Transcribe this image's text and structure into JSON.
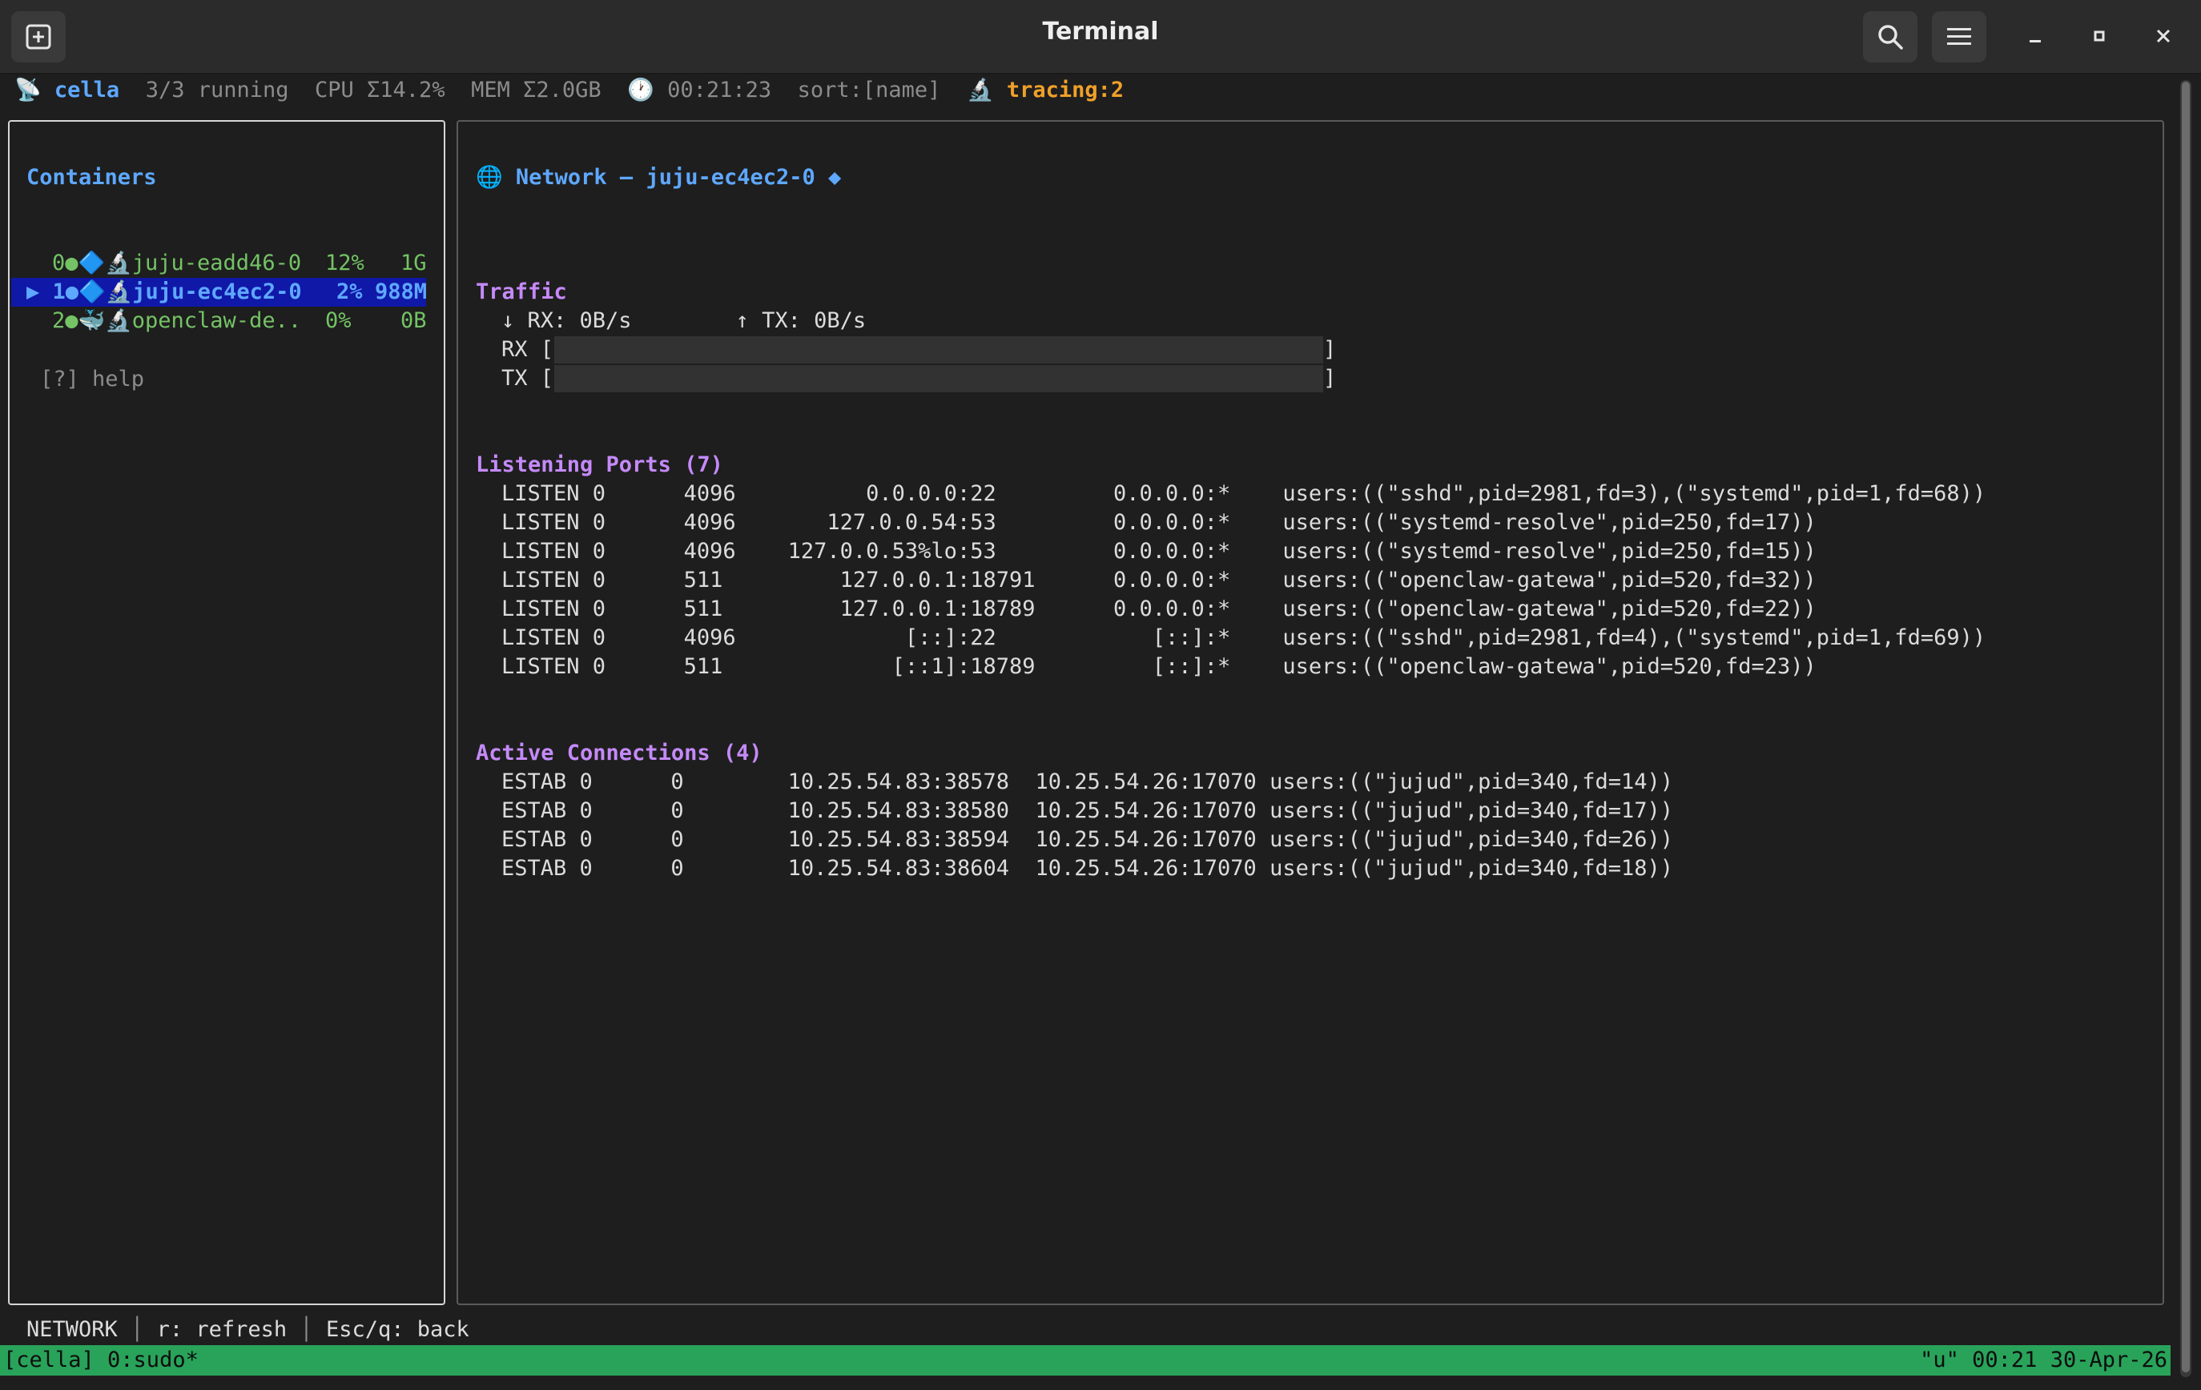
{
  "window": {
    "title": "Terminal",
    "new_tab_icon": "new-tab-icon",
    "search_icon": "search-icon",
    "menu_icon": "hamburger-menu-icon",
    "minimize_icon": "minimize-icon",
    "maximize_icon": "maximize-icon",
    "close_icon": "close-icon"
  },
  "status": {
    "host_icon": "📡",
    "host": "cella",
    "running": "3/3 running",
    "cpu": "CPU Σ14.2%",
    "mem": "MEM Σ2.0GB",
    "clock_icon": "🕐",
    "uptime": "00:21:23",
    "sort": "sort:[name]",
    "tracing_icon": "🔬",
    "tracing": "tracing:2"
  },
  "containers": {
    "title": "Containers",
    "items": [
      {
        "index": "0",
        "icons": "●🔷🔬",
        "name": "juju-eadd46-0",
        "cpu": "12%",
        "mem": "1G",
        "selected": false
      },
      {
        "index": "1",
        "icons": "●🔷🔬",
        "name": "juju-ec4ec2-0",
        "cpu": "2%",
        "mem": "988M",
        "selected": true
      },
      {
        "index": "2",
        "icons": "●🐳🔬",
        "name": "openclaw-de..",
        "cpu": "0%",
        "mem": "0B",
        "selected": false
      }
    ],
    "selector": "▶",
    "help": "[?] help"
  },
  "network": {
    "globe_icon": "🌐",
    "title": "Network — juju-ec4ec2-0",
    "diamond": "◆",
    "traffic": {
      "heading": "Traffic",
      "rates": "↓ RX: 0B/s        ↑ TX: 0B/s",
      "rx_label": "RX [",
      "tx_label": "TX [",
      "bracket_close": "]",
      "rx_fraction": 0,
      "tx_fraction": 0
    },
    "listening": {
      "heading": "Listening Ports (7)",
      "rows": [
        "LISTEN 0      4096          0.0.0.0:22         0.0.0.0:*    users:((\"sshd\",pid=2981,fd=3),(\"systemd\",pid=1,fd=68))",
        "LISTEN 0      4096       127.0.0.54:53         0.0.0.0:*    users:((\"systemd-resolve\",pid=250,fd=17))",
        "LISTEN 0      4096    127.0.0.53%lo:53         0.0.0.0:*    users:((\"systemd-resolve\",pid=250,fd=15))",
        "LISTEN 0      511         127.0.0.1:18791      0.0.0.0:*    users:((\"openclaw-gatewa\",pid=520,fd=32))",
        "LISTEN 0      511         127.0.0.1:18789      0.0.0.0:*    users:((\"openclaw-gatewa\",pid=520,fd=22))",
        "LISTEN 0      4096             [::]:22            [::]:*    users:((\"sshd\",pid=2981,fd=4),(\"systemd\",pid=1,fd=69))",
        "LISTEN 0      511             [::1]:18789         [::]:*    users:((\"openclaw-gatewa\",pid=520,fd=23))"
      ]
    },
    "active": {
      "heading": "Active Connections (4)",
      "rows": [
        "ESTAB 0      0        10.25.54.83:38578  10.25.54.26:17070 users:((\"jujud\",pid=340,fd=14))",
        "ESTAB 0      0        10.25.54.83:38580  10.25.54.26:17070 users:((\"jujud\",pid=340,fd=17))",
        "ESTAB 0      0        10.25.54.83:38594  10.25.54.26:17070 users:((\"jujud\",pid=340,fd=26))",
        "ESTAB 0      0        10.25.54.83:38604  10.25.54.26:17070 users:((\"jujud\",pid=340,fd=18))"
      ]
    }
  },
  "hints": {
    "mode": "NETWORK",
    "sep": "│",
    "refresh": "r: refresh",
    "back": "Esc/q: back"
  },
  "tmux": {
    "left": "[cella] 0:sudo*",
    "right": "\"u\" 00:21 30-Apr-26"
  },
  "colors": {
    "accent_blue": "#5ea8ff",
    "running_green": "#74c365",
    "tracing_orange": "#f0a02a",
    "heading_purple": "#c58af9",
    "selection_bg": "#1018a8",
    "tmux_green": "#29a35a"
  }
}
